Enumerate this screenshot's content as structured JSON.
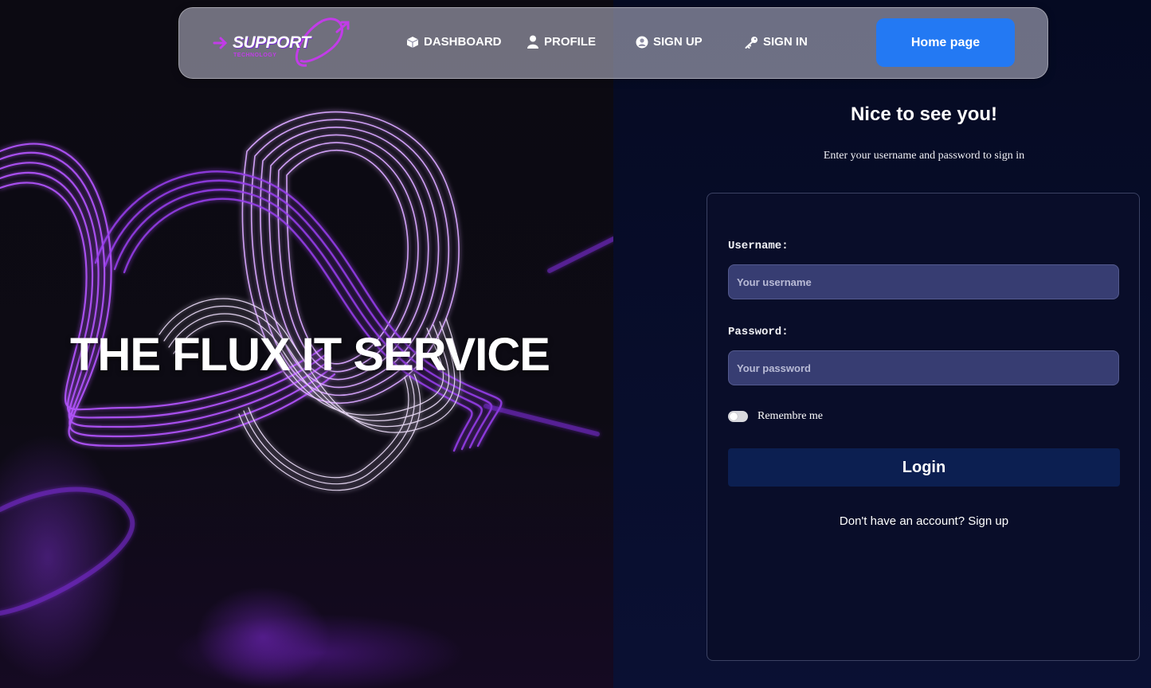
{
  "navbar": {
    "brand": "SUPPORT",
    "brand_sub": "TECHNOLOGY",
    "items": [
      {
        "label": "DASHBOARD",
        "icon": "cube-icon"
      },
      {
        "label": "PROFILE",
        "icon": "user-icon"
      },
      {
        "label": "SIGN UP",
        "icon": "user-circle-icon"
      },
      {
        "label": "SIGN IN",
        "icon": "key-icon"
      }
    ],
    "home_button": "Home page"
  },
  "hero": {
    "title": "THE FLUX IT SERVICE"
  },
  "signin": {
    "greeting": "Nice to see you!",
    "subtitle": "Enter your username and password to sign in",
    "username_label": "Username:",
    "username_placeholder": "Your username",
    "password_label": "Password:",
    "password_placeholder": "Your password",
    "remember_label": "Remembre me",
    "login_button": "Login",
    "signup_prompt": "Don't have an account? Sign up"
  },
  "colors": {
    "accent": "#2379f3",
    "login_button": "#0c1f51",
    "input_bg": "#373d72",
    "brand_purple": "#c23ce8"
  }
}
